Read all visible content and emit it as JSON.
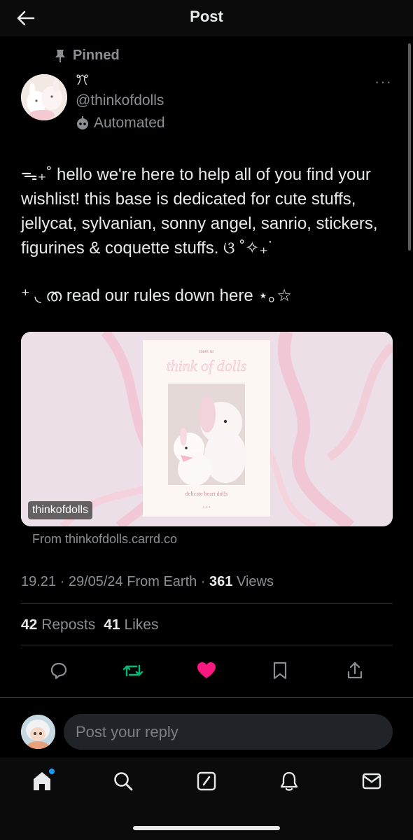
{
  "header": {
    "title": "Post"
  },
  "post": {
    "pinned_label": "Pinned",
    "display_name": "ꔫ",
    "handle": "@thinkofdolls",
    "automated_label": "Automated",
    "more_label": "···",
    "text_1": "ᯓ₊˚ hello we're here to help all of you find your wishlist! this base is dedicated for cute stuffs, jellycat, sylvanian, sonny angel, sanrio, stickers, figurines & coquette stuffs. ଓ ˚✧₊˙",
    "text_2": "⁺ ◟ ത read our rules down here ⋆｡☆",
    "card": {
      "domain_badge": "thinkofdolls",
      "source": "From thinkofdolls.carrd.co",
      "image_top_text": "meet ur",
      "image_title": "think of dolls",
      "image_caption": "delicate heart dolls",
      "image_footer": "✦✦✦"
    },
    "meta": {
      "time_date": "19.21 · 29/05/24 From Earth · ",
      "views_count": "361",
      "views_label": " Views"
    },
    "stats": {
      "reposts_count": "42",
      "reposts_label": "Reposts",
      "likes_count": "41",
      "likes_label": "Likes"
    }
  },
  "reply": {
    "placeholder": "Post your reply"
  },
  "colors": {
    "repost": "#00ba7c",
    "like": "#f91880",
    "accent": "#1d9bf0",
    "muted": "#8b8f94"
  },
  "icons": {
    "header": "back-arrow-icon",
    "actions": [
      "reply-icon",
      "repost-icon",
      "like-icon",
      "bookmark-icon",
      "share-icon"
    ],
    "nav": [
      "home-icon",
      "search-icon",
      "compose-icon",
      "notifications-icon",
      "messages-icon"
    ]
  }
}
